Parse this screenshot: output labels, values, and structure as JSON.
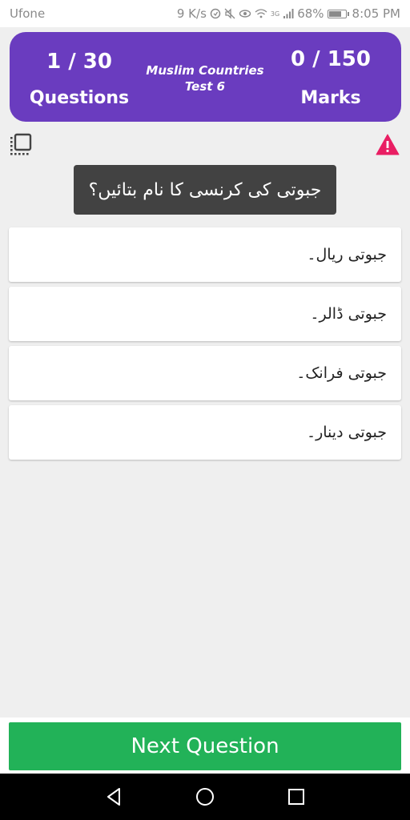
{
  "status_bar": {
    "carrier": "Ufone",
    "speed": "9 K/s",
    "network": "3G",
    "battery": "68%",
    "battery_level": 0.68,
    "time": "8:05 PM"
  },
  "header": {
    "questions_count": "1 / 30",
    "questions_label": "Questions",
    "test_title_line1": "Muslim Countries",
    "test_title_line2": "Test 6",
    "marks_count": "0 / 150",
    "marks_label": "Marks",
    "bg_color": "#6a3cbf"
  },
  "icons": {
    "left_tool": "select-all-icon",
    "right_tool": "warning-icon",
    "warning_color": "#e91e63"
  },
  "question": {
    "text": "جبوتی کی کرنسی کا نام بتائیں؟"
  },
  "options": [
    {
      "label": "جبوتی ریال۔"
    },
    {
      "label": "جبوتی ڈالر۔"
    },
    {
      "label": "جبوتی فرانک۔"
    },
    {
      "label": "جبوتی دینار۔"
    }
  ],
  "next_button": {
    "label": "Next Question",
    "color": "#22b258"
  },
  "nav_bar": {
    "back": "back-icon",
    "home": "home-icon",
    "recent": "recent-apps-icon"
  }
}
